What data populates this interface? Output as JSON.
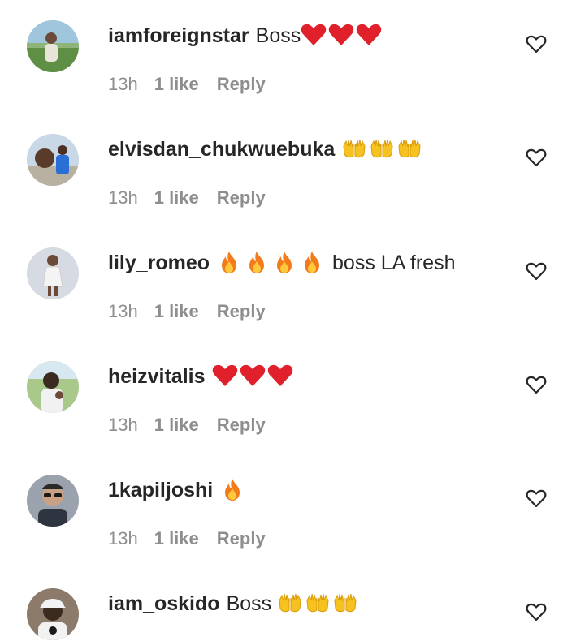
{
  "comments": [
    {
      "username": "iamforeignstar",
      "text_before": "Boss",
      "emojis": [
        "red-heart",
        "red-heart",
        "red-heart"
      ],
      "text_after": "",
      "time": "13h",
      "likes": "1 like",
      "reply": "Reply",
      "avatar": "green-lawn-photo"
    },
    {
      "username": "elvisdan_chukwuebuka",
      "text_before": "",
      "emojis": [
        "raising-hands",
        "raising-hands",
        "raising-hands"
      ],
      "text_after": "",
      "time": "13h",
      "likes": "1 like",
      "reply": "Reply",
      "avatar": "blue-shirt-photo"
    },
    {
      "username": "lily_romeo",
      "text_before": "",
      "emojis": [
        "fire",
        "fire",
        "fire",
        "fire"
      ],
      "text_after": "boss LA fresh",
      "time": "13h",
      "likes": "1 like",
      "reply": "Reply",
      "avatar": "white-dress-photo"
    },
    {
      "username": "heizvitalis",
      "text_before": "",
      "emojis": [
        "red-heart",
        "red-heart",
        "red-heart"
      ],
      "text_after": "",
      "time": "13h",
      "likes": "1 like",
      "reply": "Reply",
      "avatar": "outdoor-green-photo"
    },
    {
      "username": "1kapiljoshi",
      "text_before": "",
      "emojis": [
        "fire"
      ],
      "text_after": "",
      "time": "13h",
      "likes": "1 like",
      "reply": "Reply",
      "avatar": "sunglasses-photo"
    },
    {
      "username": "iam_oskido",
      "text_before": "Boss",
      "emojis": [
        "raising-hands",
        "raising-hands",
        "raising-hands"
      ],
      "text_after": "",
      "time": "13h",
      "likes": "",
      "reply": "",
      "avatar": "white-cap-photo"
    }
  ],
  "colors": {
    "text": "#262626",
    "meta": "#8e8e8e",
    "heart_red": "#e0202a",
    "hands_yellow": "#f6c21f",
    "fire_orange": "#f47b1b"
  },
  "icons": {
    "like": "heart-outline-icon"
  }
}
